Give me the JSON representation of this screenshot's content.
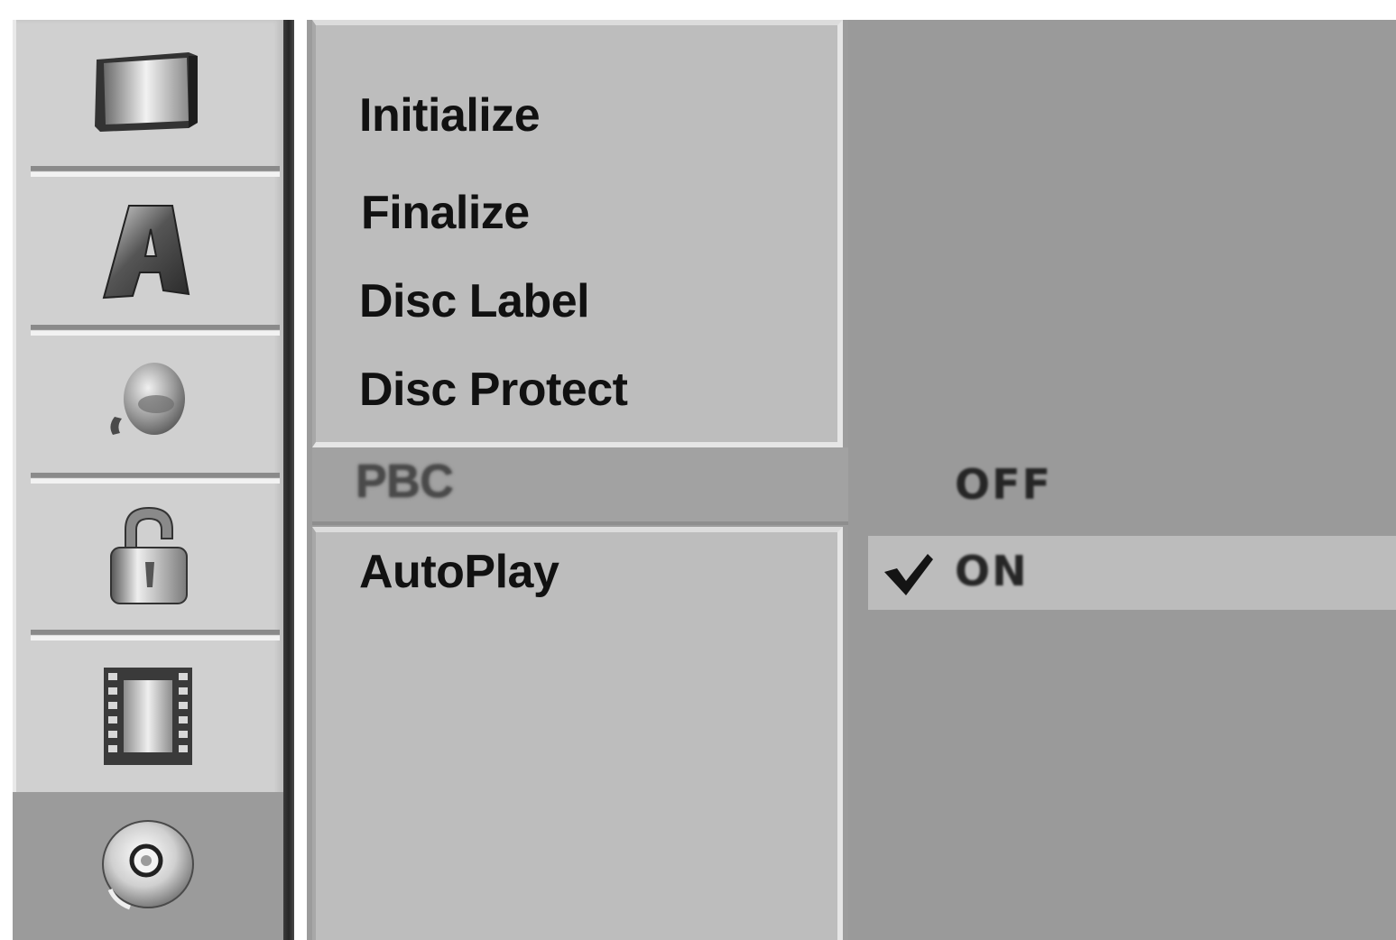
{
  "sidebar": {
    "items": [
      {
        "icon": "tv-icon",
        "active": false
      },
      {
        "icon": "language-icon",
        "active": false
      },
      {
        "icon": "audio-icon",
        "active": false
      },
      {
        "icon": "lock-icon",
        "active": false
      },
      {
        "icon": "film-icon",
        "active": false
      },
      {
        "icon": "disc-icon",
        "active": true
      }
    ]
  },
  "menu": {
    "items": [
      {
        "label": "Initialize"
      },
      {
        "label": "Finalize"
      },
      {
        "label": "Disc Label"
      },
      {
        "label": "Disc Protect"
      },
      {
        "label": "PBC",
        "selected": true
      },
      {
        "label": "AutoPlay"
      }
    ]
  },
  "options": {
    "items": [
      {
        "label": "OFF",
        "checked": false
      },
      {
        "label": "ON",
        "checked": true,
        "icon": "checkmark-icon"
      }
    ]
  },
  "colors": {
    "sidebar_bg": "#d0d0d0",
    "menu_box_bg": "#bdbdbd",
    "panel_bg": "#9a9a9a",
    "selected_bg": "#a2a2a2",
    "highlight_bg": "#bcbcbc",
    "text": "#111111"
  }
}
